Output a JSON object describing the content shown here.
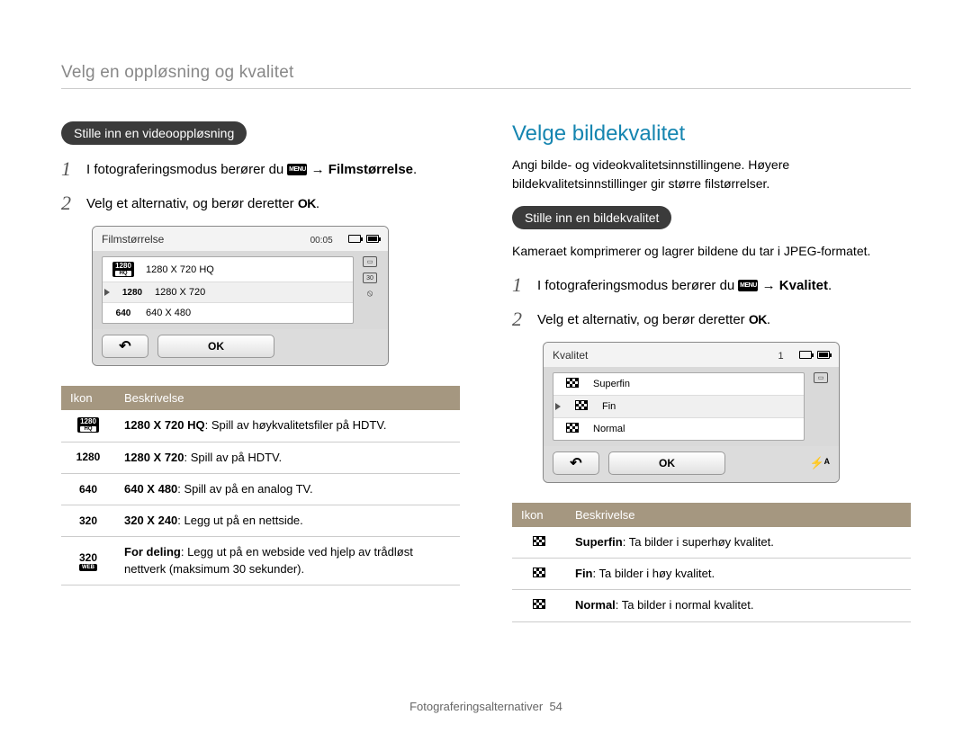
{
  "breadcrumb": "Velg en oppløsning og kvalitet",
  "left": {
    "pill": "Stille inn en videooppløsning",
    "step1_a": "I fotograferingsmodus berører du ",
    "step1_menu": "MENU",
    "step1_b": " → ",
    "step1_bold": "Filmstørrelse",
    "step1_c": ".",
    "step2_a": "Velg et alternativ, og berør deretter ",
    "step2_ok": "OK",
    "step2_b": ".",
    "screen": {
      "title": "Filmstørrelse",
      "time": "00:05",
      "rows": [
        {
          "icon": "1280HQ",
          "label": "1280 X 720 HQ"
        },
        {
          "icon": "1280",
          "label": "1280 X 720"
        },
        {
          "icon": "640",
          "label": "640 X 480"
        }
      ],
      "ok": "OK"
    },
    "table": {
      "h1": "Ikon",
      "h2": "Beskrivelse",
      "rows": [
        {
          "icon": "1280HQ",
          "bold": "1280 X 720 HQ",
          "text": ": Spill av høykvalitetsfiler på HDTV."
        },
        {
          "icon": "1280",
          "bold": "1280 X 720",
          "text": ": Spill av på HDTV."
        },
        {
          "icon": "640",
          "bold": "640 X 480",
          "text": ": Spill av på en analog TV."
        },
        {
          "icon": "320",
          "bold": "320 X 240",
          "text": ": Legg ut på en nettside."
        },
        {
          "icon": "320WEB",
          "bold": "For deling",
          "text": ": Legg ut på en webside ved hjelp av trådløst nettverk (maksimum 30 sekunder)."
        }
      ]
    }
  },
  "right": {
    "title": "Velge bildekvalitet",
    "lead": "Angi bilde- og videokvalitetsinnstillingene. Høyere bildekvalitetsinnstillinger gir større filstørrelser.",
    "pill": "Stille inn en bildekvalitet",
    "note": "Kameraet komprimerer og lagrer bildene du tar i JPEG-formatet.",
    "step1_a": "I fotograferingsmodus berører du ",
    "step1_menu": "MENU",
    "step1_b": " → ",
    "step1_bold": "Kvalitet",
    "step1_c": ".",
    "step2_a": "Velg et alternativ, og berør deretter ",
    "step2_ok": "OK",
    "step2_b": ".",
    "screen": {
      "title": "Kvalitet",
      "count": "1",
      "rows": [
        {
          "label": "Superfin"
        },
        {
          "label": "Fin"
        },
        {
          "label": "Normal"
        }
      ],
      "ok": "OK"
    },
    "table": {
      "h1": "Ikon",
      "h2": "Beskrivelse",
      "rows": [
        {
          "bold": "Superfin",
          "text": ": Ta bilder i superhøy kvalitet."
        },
        {
          "bold": "Fin",
          "text": ": Ta bilder i høy kvalitet."
        },
        {
          "bold": "Normal",
          "text": ": Ta bilder i normal kvalitet."
        }
      ]
    }
  },
  "footer_a": "Fotograferingsalternativer",
  "footer_b": "54"
}
